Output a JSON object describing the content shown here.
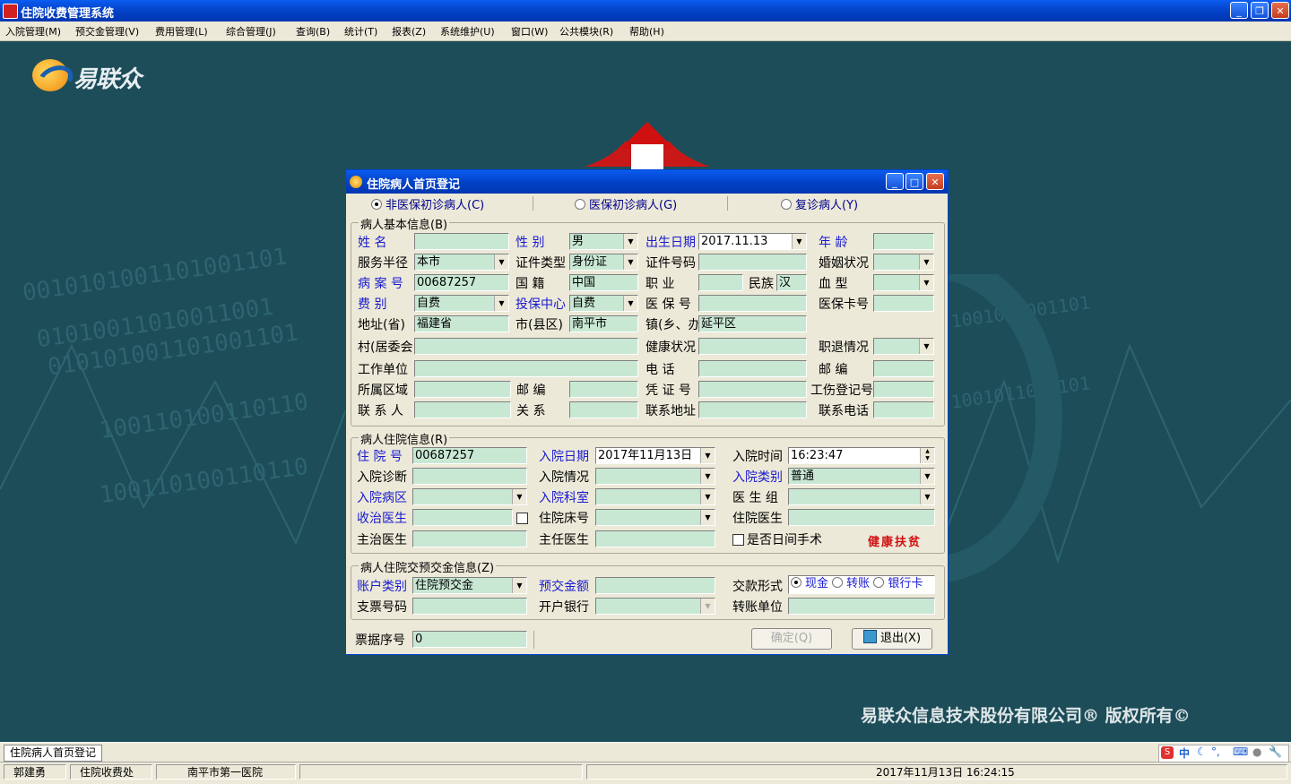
{
  "window": {
    "title": "住院收费管理系统"
  },
  "menu": [
    "入院管理(M)",
    "预交金管理(V)",
    "费用管理(L)",
    "综合管理(J)",
    "查询(B)",
    "统计(T)",
    "报表(Z)",
    "系统维护(U)",
    "窗口(W)",
    "公共模块(R)",
    "帮助(H)"
  ],
  "brand": {
    "logo_text": "易联众",
    "copyright": "易联众信息技术股份有限公司®  版权所有©"
  },
  "dialog": {
    "title": "住院病人首页登记",
    "tabs": [
      "非医保初诊病人(C)",
      "医保初诊病人(G)",
      "复诊病人(Y)"
    ],
    "basic": {
      "legend": "病人基本信息(B)",
      "labels": {
        "name": "姓    名",
        "sex": "性    别",
        "birth": "出生日期",
        "age": "年    龄",
        "service_radius": "服务半径",
        "id_type": "证件类型",
        "id_no": "证件号码",
        "marriage": "婚姻状况",
        "record_no": "病 案 号",
        "nationality": "国    籍",
        "job": "职    业",
        "ethnic": "民族",
        "blood": "血    型",
        "fee_type": "费    别",
        "insure_center": "投保中心",
        "insure_no": "医 保 号",
        "card_no": "医保卡号",
        "province": "地址(省)",
        "city": "市(县区)",
        "town": "镇(乡、办",
        "village": "村(居委会",
        "health": "健康状况",
        "retire": "职退情况",
        "work_unit": "工作单位",
        "phone": "电    话",
        "postcode": "邮    编",
        "area": "所属区域",
        "postcode2": "邮    编",
        "cert_no": "凭 证 号",
        "injury_no": "工伤登记号",
        "contact": "联 系 人",
        "relation": "关    系",
        "contact_addr": "联系地址",
        "contact_phone": "联系电话"
      },
      "values": {
        "sex": "男",
        "birth": "2017.11.13",
        "service_radius": "本市",
        "id_type": "身份证",
        "record_no": "00687257",
        "nationality": "中国",
        "ethnic": "汉",
        "fee_type": "自费",
        "insure_center": "自费",
        "province": "福建省",
        "city": "南平市",
        "town": "延平区"
      }
    },
    "inpatient": {
      "legend": "病人住院信息(R)",
      "labels": {
        "inpatient_no": "住 院 号",
        "admit_date": "入院日期",
        "admit_time": "入院时间",
        "admit_diag": "入院诊断",
        "admit_cond": "入院情况",
        "admit_type": "入院类别",
        "ward": "入院病区",
        "dept": "入院科室",
        "doctor_group": "医 生 组",
        "attending": "收治医生",
        "bed": "住院床号",
        "resident": "住院医生",
        "chief": "主治医生",
        "director": "主任医生",
        "day_surgery": "是否日间手术"
      },
      "values": {
        "inpatient_no": "00687257",
        "admit_date": "2017年11月13日",
        "admit_time": "16:23:47",
        "admit_type": "普通"
      },
      "note": "健康扶贫"
    },
    "deposit": {
      "legend": "病人住院交预交金信息(Z)",
      "labels": {
        "account_type": "账户类别",
        "amount": "预交金额",
        "pay_method": "交款形式",
        "check_no": "支票号码",
        "bank": "开户银行",
        "transfer_unit": "转账单位"
      },
      "values": {
        "account_type": "住院预交金"
      },
      "pay_options": [
        "现金",
        "转账",
        "银行卡"
      ]
    },
    "receipt": {
      "label": "票据序号",
      "value": "0"
    },
    "buttons": {
      "ok": "确定(Q)",
      "exit": "退出(X)"
    }
  },
  "taskbar": {
    "tab": "住院病人首页登记",
    "ime": "中"
  },
  "status": {
    "user": "郭建勇",
    "dept": "住院收费处",
    "hospital": "南平市第一医院",
    "datetime": "2017年11月13日  16:24:15"
  },
  "colors": {
    "workspace": "#1c4d59",
    "field": "#c8e8d4",
    "label_blue": "#1a1ad0",
    "note_red": "#d01010"
  }
}
